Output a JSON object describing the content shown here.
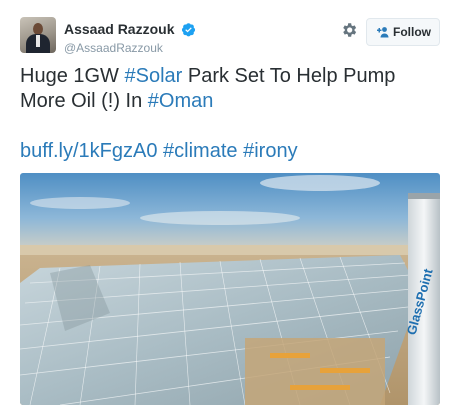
{
  "user": {
    "display_name": "Assaad Razzouk",
    "handle": "@AssaadRazzouk",
    "avatar_icon": "profile-photo",
    "verified_icon": "verified-badge-icon"
  },
  "actions": {
    "settings_icon": "gear-icon",
    "follow_label": "Follow",
    "follow_icon": "add-person-icon"
  },
  "tweet": {
    "line1": {
      "t1": "Huge 1GW ",
      "h1": "#Solar",
      "t2": " Park Set To Help Pump"
    },
    "line2": {
      "t1": "More Oil (!) In ",
      "h1": "#Oman"
    },
    "line3": {
      "link": "buff.ly/1kFgzA0",
      "sp1": " ",
      "h1": "#climate",
      "sp2": " ",
      "h2": "#irony"
    }
  },
  "media": {
    "description_icon": "solar-greenhouse-photo",
    "tank_brand": "GlassPoint"
  },
  "colors": {
    "link": "#2b7bb9",
    "text": "#292f33",
    "muted": "#8899a6",
    "verified": "#1da1f2"
  }
}
